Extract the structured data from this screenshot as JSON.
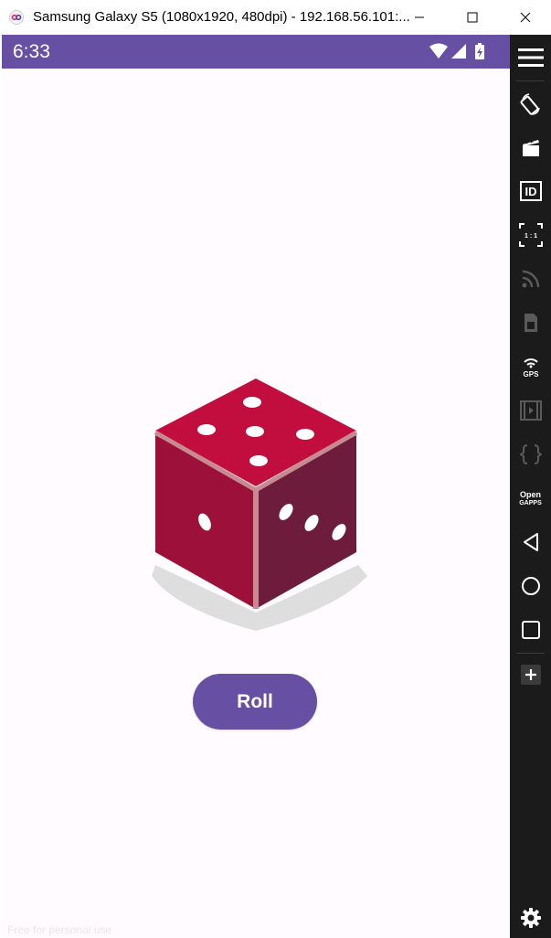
{
  "window": {
    "title": "Samsung Galaxy S5 (1080x1920, 480dpi) - 192.168.56.101:...",
    "controls": [
      "minimize-icon",
      "maximize-icon",
      "close-icon"
    ]
  },
  "status_bar": {
    "time": "6:33",
    "icons": [
      "wifi-icon",
      "cell-signal-icon",
      "battery-charging-icon"
    ],
    "color": "#6750a4"
  },
  "dice": {
    "top_face_pips": 5,
    "left_face_pips": 1,
    "right_face_pips": 3,
    "colors": {
      "top": "#c20e3e",
      "left": "#9c103a",
      "right": "#6d1d3b",
      "edge": "#c78a90",
      "shadow": "#dedede"
    }
  },
  "roll_button": {
    "label": "Roll",
    "color": "#6750a4"
  },
  "watermark": "Free for personal use",
  "side_toolbar": {
    "items": [
      "menu-icon",
      "rotate-icon",
      "screen-record-icon",
      "device-id-icon",
      "pixel-perfect-icon",
      "network-icon",
      "sim-icon",
      "gps-icon",
      "media-icon",
      "api-icon",
      "open-gapps-icon",
      "back-icon",
      "home-icon",
      "recents-icon",
      "add-icon",
      "settings-icon"
    ],
    "id_label": "ID",
    "pixel_label": "1 : 1",
    "gps_label": "GPS",
    "gapps_label_1": "Open",
    "gapps_label_2": "GAPPS"
  }
}
